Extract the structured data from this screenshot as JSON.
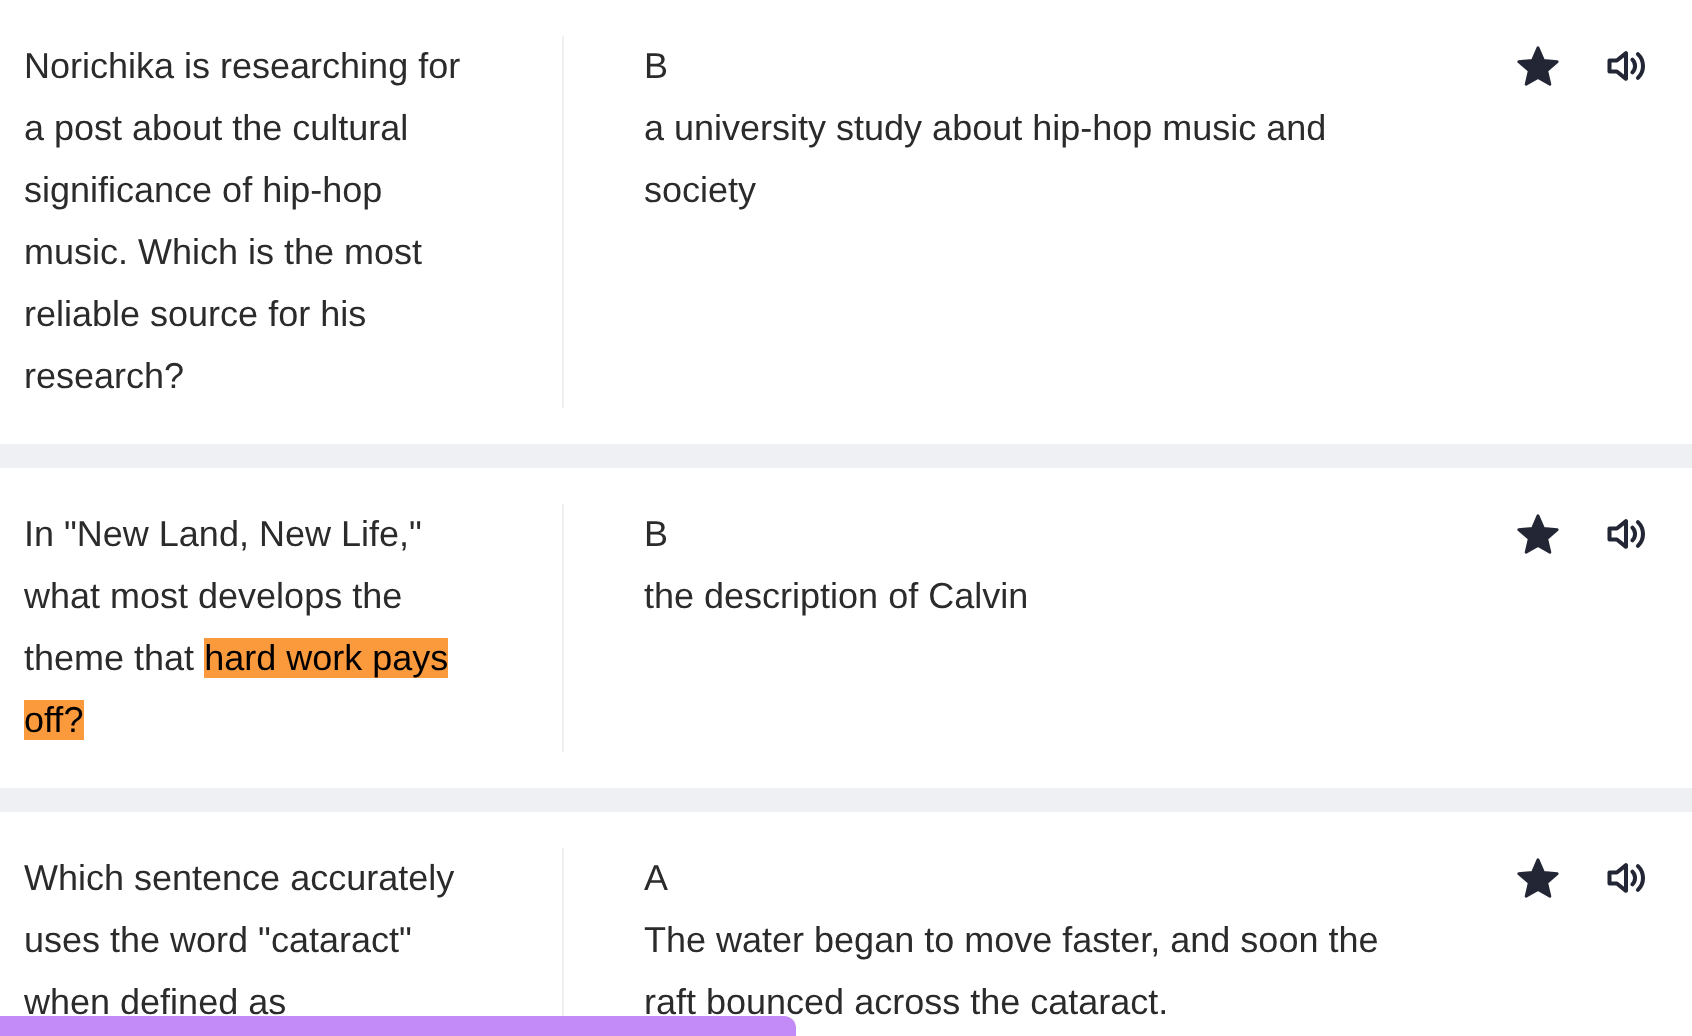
{
  "cards": [
    {
      "question": [
        {
          "text": "Norichika is researching for a post about the cultural significance of hip-hop music. Which is the most reliable source for his research?",
          "highlighted": false
        }
      ],
      "answer_letter": "B",
      "answer": "a university study about hip-hop music and society",
      "starred": true
    },
    {
      "question": [
        {
          "text": "In \"New Land, New Life,\" what most develops the theme that ",
          "highlighted": false
        },
        {
          "text": "hard work pays off?",
          "highlighted": true
        }
      ],
      "answer_letter": "B",
      "answer": "the description of Calvin",
      "starred": true
    },
    {
      "question": [
        {
          "text": "Which sentence accurately uses the word \"cataract\" when defined as",
          "highlighted": false
        }
      ],
      "answer_letter": "A",
      "answer": "The water began to move faster, and soon the raft bounced across the cataract.",
      "starred": true
    }
  ],
  "progress": {
    "level": 0.47
  }
}
